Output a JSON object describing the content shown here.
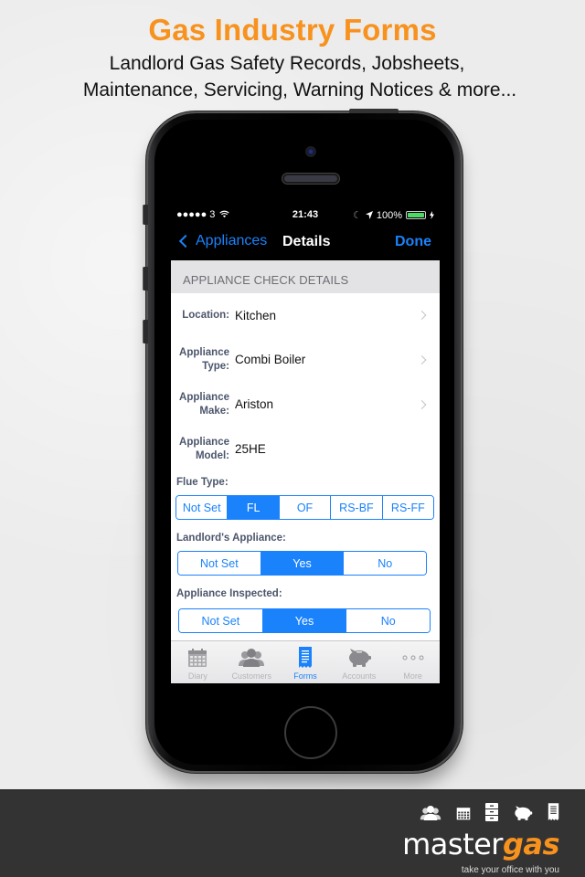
{
  "promo": {
    "title": "Gas Industry Forms",
    "subtitle_line1": "Landlord Gas Safety Records, Jobsheets,",
    "subtitle_line2": "Maintenance, Servicing, Warning Notices & more..."
  },
  "statusbar": {
    "signal": "●●●●● 3",
    "wifi_icon": "wifi-icon",
    "time": "21:43",
    "moon_icon": "moon-icon",
    "location_icon": "location-arrow-icon",
    "battery_text": "100%",
    "battery_level": 1.0,
    "battery_color": "#4cd964",
    "charging_icon": "bolt-icon"
  },
  "navbar": {
    "back_label": "Appliances",
    "title": "Details",
    "done_label": "Done",
    "accent_color": "#1a82fb"
  },
  "form": {
    "section_header": "APPLIANCE CHECK DETAILS",
    "fields": [
      {
        "label": "Location:",
        "value": "Kitchen",
        "disclosure": true
      },
      {
        "label_line1": "Appliance",
        "label_line2": "Type:",
        "value": "Combi Boiler",
        "disclosure": true
      },
      {
        "label_line1": "Appliance",
        "label_line2": "Make:",
        "value": "Ariston",
        "disclosure": true
      },
      {
        "label_line1": "Appliance",
        "label_line2": "Model:",
        "value": "25HE",
        "disclosure": false
      }
    ],
    "flue_type": {
      "label": "Flue Type:",
      "options": [
        "Not Set",
        "FL",
        "OF",
        "RS-BF",
        "RS-FF"
      ],
      "selected": "FL"
    },
    "landlords_appliance": {
      "label": "Landlord's Appliance:",
      "options": [
        "Not Set",
        "Yes",
        "No"
      ],
      "selected": "Yes"
    },
    "appliance_inspected": {
      "label": "Appliance Inspected:",
      "options": [
        "Not Set",
        "Yes",
        "No"
      ],
      "selected": "Yes"
    }
  },
  "tabbar": {
    "items": [
      {
        "label": "Diary",
        "icon": "calendar-icon",
        "active": false
      },
      {
        "label": "Customers",
        "icon": "people-icon",
        "active": false
      },
      {
        "label": "Forms",
        "icon": "receipt-icon",
        "active": true
      },
      {
        "label": "Accounts",
        "icon": "piggy-bank-icon",
        "active": false
      },
      {
        "label": "More",
        "icon": "more-dots-icon",
        "active": false
      }
    ]
  },
  "footer": {
    "icons": [
      "people-icon",
      "calendar-icon",
      "filing-cabinet-icon",
      "piggy-bank-icon",
      "receipt-icon"
    ],
    "logo_part1": "master",
    "logo_part2": "gas",
    "tagline": "take your office with you",
    "brand_color": "#f7921e"
  }
}
